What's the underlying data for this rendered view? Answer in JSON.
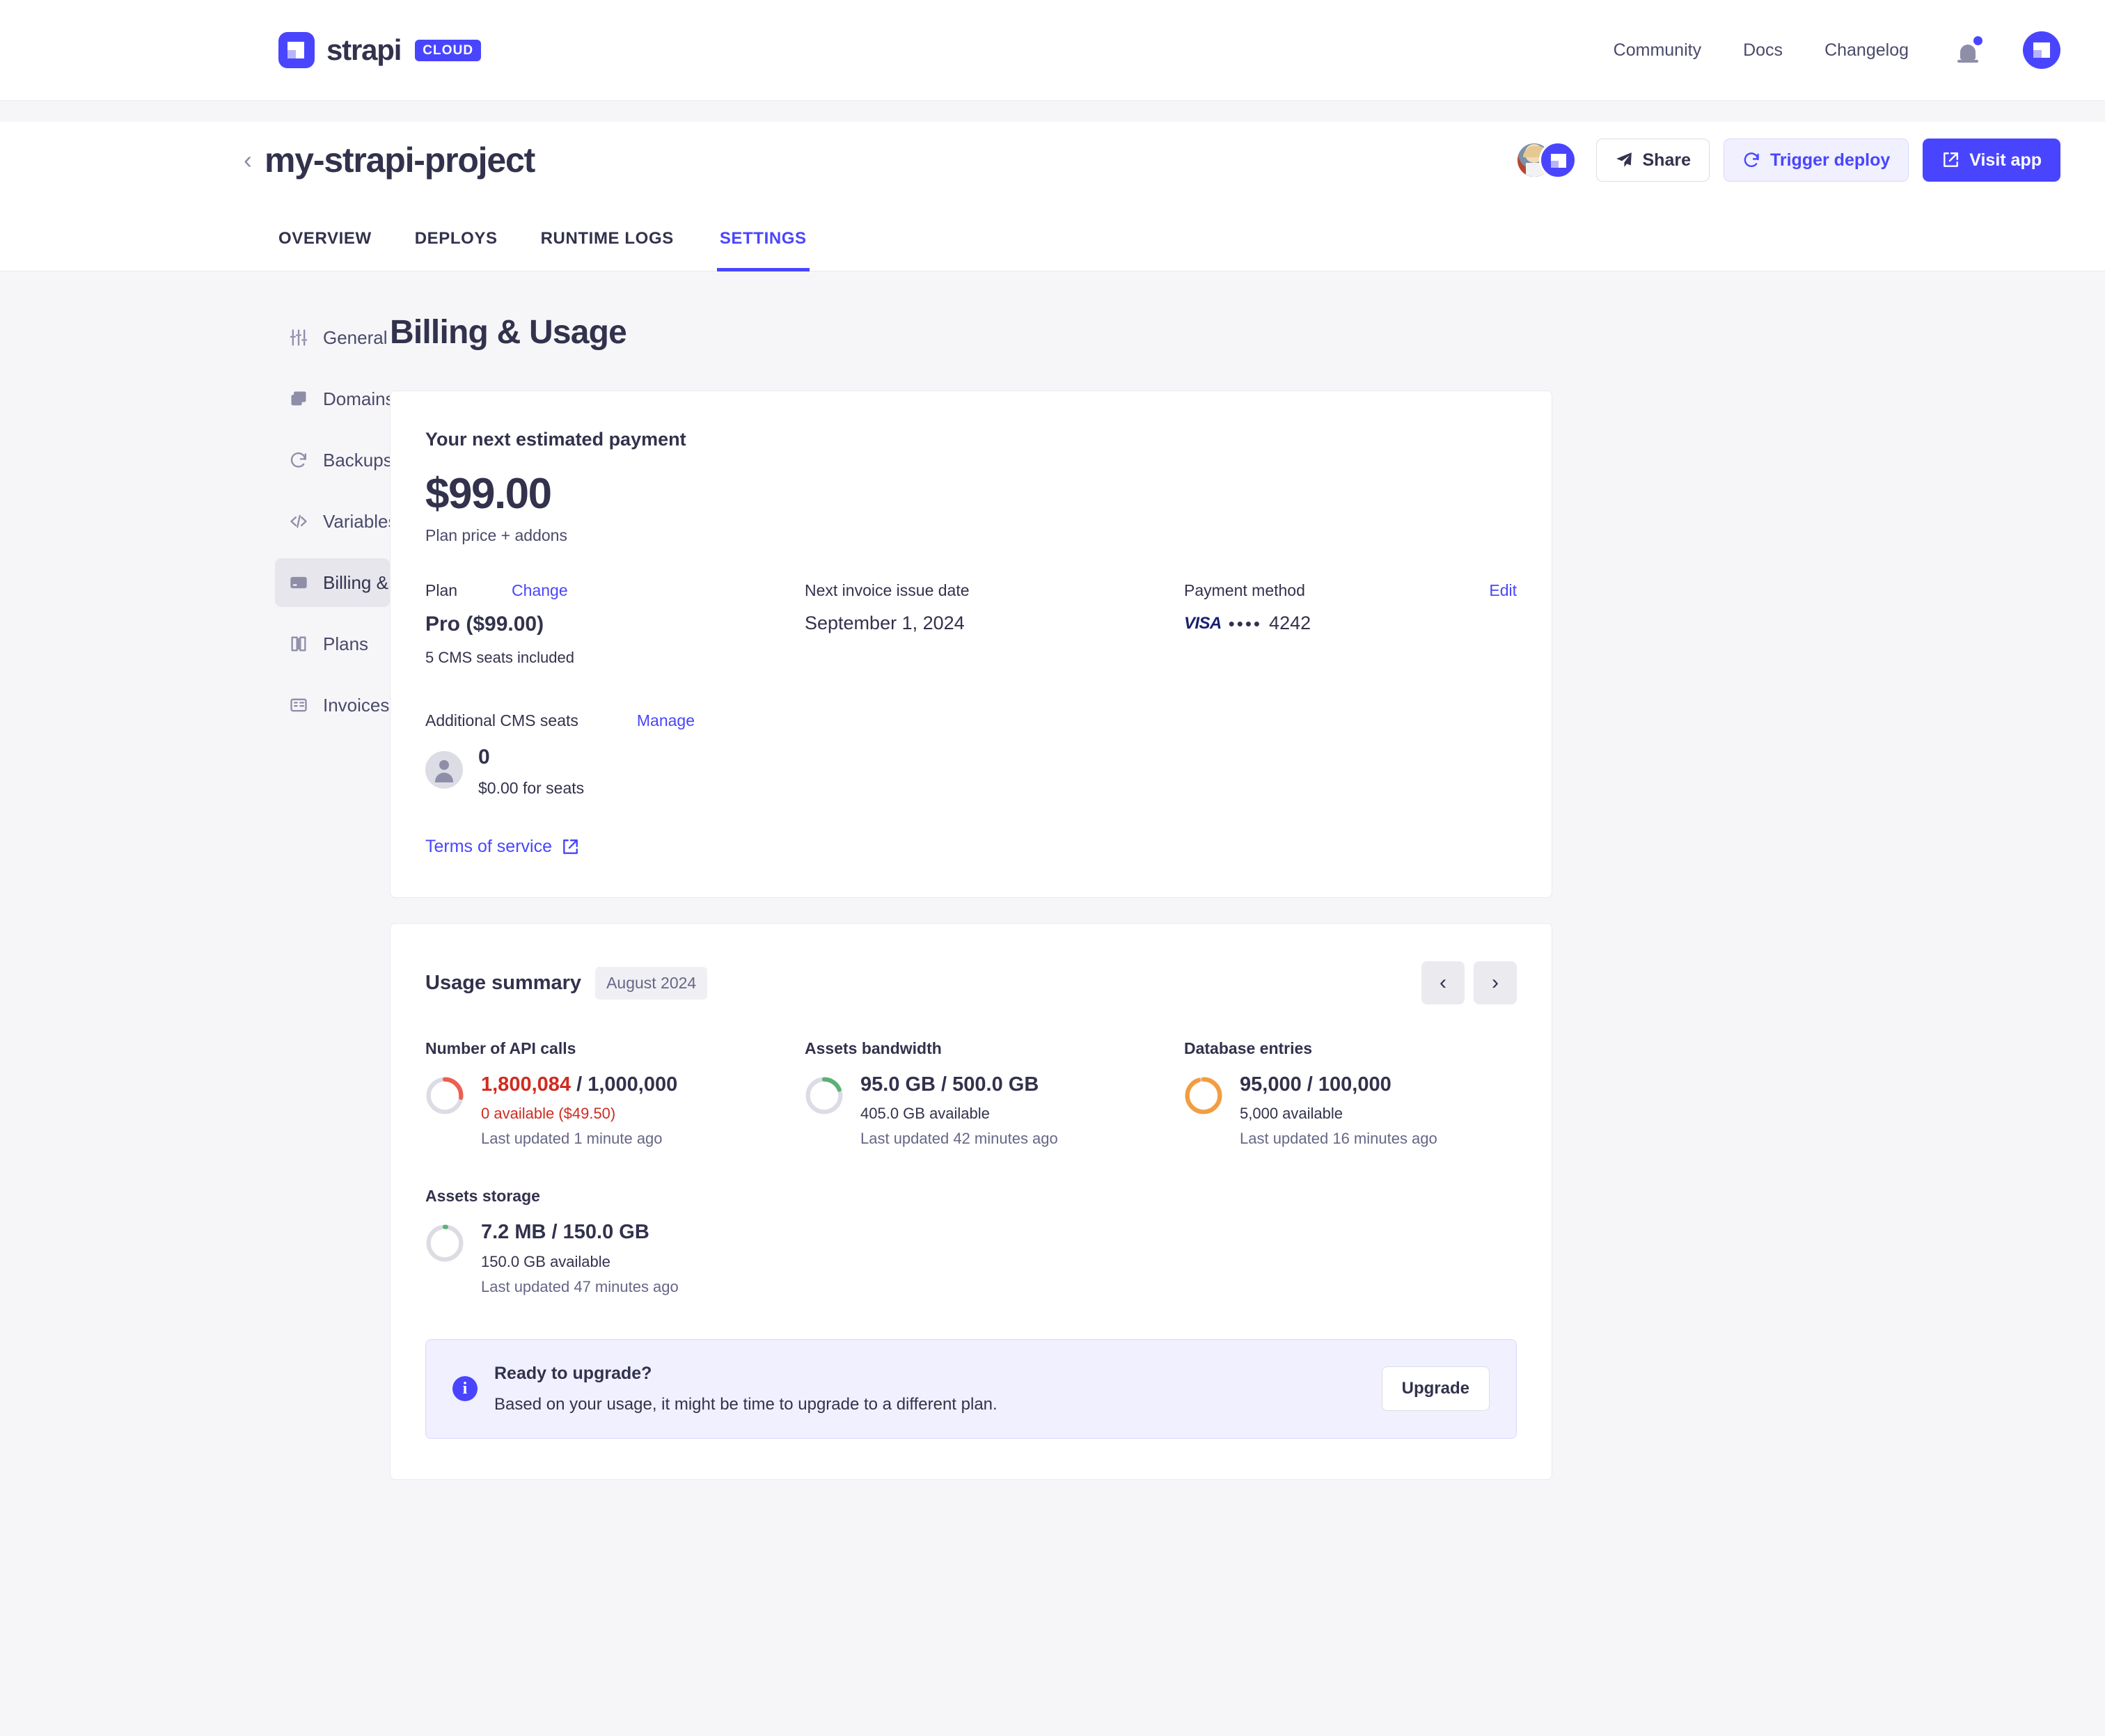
{
  "topnav": {
    "brand": {
      "word": "strapi",
      "badge": "CLOUD"
    },
    "links": [
      {
        "label": "Community"
      },
      {
        "label": "Docs"
      },
      {
        "label": "Changelog"
      }
    ]
  },
  "project": {
    "title": "my-strapi-project",
    "actions": {
      "share": "Share",
      "trigger_deploy": "Trigger deploy",
      "visit_app": "Visit app"
    }
  },
  "tabs": [
    {
      "label": "OVERVIEW",
      "active": false
    },
    {
      "label": "DEPLOYS",
      "active": false
    },
    {
      "label": "RUNTIME LOGS",
      "active": false
    },
    {
      "label": "SETTINGS",
      "active": true
    }
  ],
  "sidebar": {
    "items": [
      {
        "label": "General",
        "icon": "sliders-icon"
      },
      {
        "label": "Domains",
        "icon": "layers-icon"
      },
      {
        "label": "Backups",
        "icon": "refresh-icon"
      },
      {
        "label": "Variables",
        "icon": "code-icon"
      },
      {
        "label": "Billing & Usage",
        "icon": "credit-card-icon"
      },
      {
        "label": "Plans",
        "icon": "book-icon"
      },
      {
        "label": "Invoices",
        "icon": "receipt-icon"
      }
    ]
  },
  "main": {
    "page_title": "Billing & Usage",
    "payment_card": {
      "heading": "Your next estimated payment",
      "amount": "$99.00",
      "amount_sub": "Plan price + addons",
      "plan": {
        "label": "Plan",
        "change_link": "Change",
        "value": "Pro ($99.00)",
        "note": "5 CMS seats included"
      },
      "invoice": {
        "label": "Next invoice issue date",
        "value": "September 1, 2024"
      },
      "payment_method": {
        "label": "Payment method",
        "edit_link": "Edit",
        "brand": "VISA",
        "mask": "••••",
        "digits": "4242"
      },
      "seats": {
        "label": "Additional CMS seats",
        "manage_link": "Manage",
        "count": "0",
        "price": "$0.00 for seats"
      },
      "terms_link": "Terms of service"
    },
    "usage_card": {
      "title": "Usage summary",
      "period_badge": "August 2024",
      "prev_label": "‹",
      "next_label": "›",
      "metrics": [
        {
          "label": "Number of API calls",
          "used": "1,800,084",
          "separator": " / ",
          "limit": "1,000,000",
          "over": true,
          "available": "0 available ($49.50)",
          "updated": "Last updated 1 minute ago",
          "percent": 100,
          "ring_color": "#ee5e52",
          "ring_arc": 27
        },
        {
          "label": "Assets bandwidth",
          "used": "95.0 GB",
          "separator": " / ",
          "limit": "500.0 GB",
          "over": false,
          "available": "405.0 GB available",
          "updated": "Last updated 42 minutes ago",
          "percent": 19,
          "ring_color": "#5cb176",
          "ring_arc": 19
        },
        {
          "label": "Database entries",
          "used": "95,000",
          "separator": " / ",
          "limit": "100,000",
          "over": false,
          "available": "5,000 available",
          "updated": "Last updated 16 minutes ago",
          "percent": 95,
          "ring_color": "#f29d41",
          "ring_arc": 95
        },
        {
          "label": "Assets storage",
          "used": "7.2 MB",
          "separator": " / ",
          "limit": "150.0 GB",
          "over": false,
          "available": "150.0 GB available",
          "updated": "Last updated 47 minutes ago",
          "percent": 1,
          "ring_color": "#5cb176",
          "ring_arc": 2
        }
      ],
      "banner": {
        "title": "Ready to upgrade?",
        "text": "Based on your usage, it might be time to upgrade to a different plan.",
        "button": "Upgrade",
        "icon_glyph": "i"
      }
    }
  },
  "colors": {
    "accent": "#4945ff",
    "danger": "#d02b20",
    "success": "#5cb176",
    "warning": "#f29d41",
    "text": "#32324d",
    "muted": "#666687",
    "page_bg": "#f6f6f9"
  }
}
